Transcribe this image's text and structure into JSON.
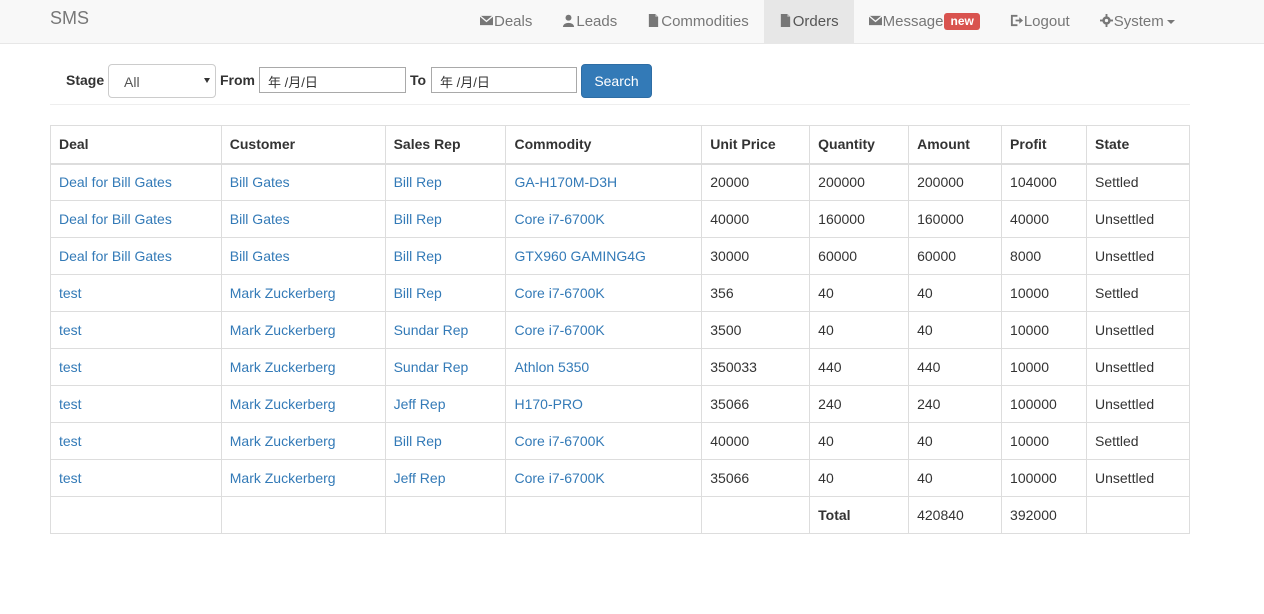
{
  "navbar": {
    "brand": "SMS",
    "items": [
      {
        "label": "Deals",
        "icon": "envelope-icon",
        "active": false
      },
      {
        "label": "Leads",
        "icon": "user-icon",
        "active": false
      },
      {
        "label": "Commodities",
        "icon": "file-icon",
        "active": false
      },
      {
        "label": "Orders",
        "icon": "file-icon",
        "active": true
      },
      {
        "label": "Message",
        "icon": "envelope-icon",
        "active": false,
        "badge": "new"
      },
      {
        "label": "Logout",
        "icon": "logout-icon",
        "active": false
      },
      {
        "label": "System",
        "icon": "gear-icon",
        "active": false,
        "dropdown": true
      }
    ]
  },
  "filter": {
    "stage_label": "Stage",
    "stage_value": "All",
    "from_label": "From",
    "from_value": "年 /月/日",
    "to_label": "To",
    "to_value": "年 /月/日",
    "search_label": "Search"
  },
  "table": {
    "headers": [
      "Deal",
      "Customer",
      "Sales Rep",
      "Commodity",
      "Unit Price",
      "Quantity",
      "Amount",
      "Profit",
      "State"
    ],
    "rows": [
      [
        "Deal for Bill Gates",
        "Bill Gates",
        "Bill Rep",
        "GA-H170M-D3H",
        "20000",
        "200000",
        "200000",
        "104000",
        "Settled"
      ],
      [
        "Deal for Bill Gates",
        "Bill Gates",
        "Bill Rep",
        "Core i7-6700K",
        "40000",
        "160000",
        "160000",
        "40000",
        "Unsettled"
      ],
      [
        "Deal for Bill Gates",
        "Bill Gates",
        "Bill Rep",
        "GTX960 GAMING4G",
        "30000",
        "60000",
        "60000",
        "8000",
        "Unsettled"
      ],
      [
        "test",
        "Mark Zuckerberg",
        "Bill Rep",
        "Core i7-6700K",
        "356",
        "40",
        "40",
        "10000",
        "Settled"
      ],
      [
        "test",
        "Mark Zuckerberg",
        "Sundar Rep",
        "Core i7-6700K",
        "3500",
        "40",
        "40",
        "10000",
        "Unsettled"
      ],
      [
        "test",
        "Mark Zuckerberg",
        "Sundar Rep",
        "Athlon 5350",
        "350033",
        "440",
        "440",
        "10000",
        "Unsettled"
      ],
      [
        "test",
        "Mark Zuckerberg",
        "Jeff Rep",
        "H170-PRO",
        "35066",
        "240",
        "240",
        "100000",
        "Unsettled"
      ],
      [
        "test",
        "Mark Zuckerberg",
        "Bill Rep",
        "Core i7-6700K",
        "40000",
        "40",
        "40",
        "10000",
        "Settled"
      ],
      [
        "test",
        "Mark Zuckerberg",
        "Jeff Rep",
        "Core i7-6700K",
        "35066",
        "40",
        "40",
        "100000",
        "Unsettled"
      ]
    ],
    "total_label": "Total",
    "total_amount": "420840",
    "total_profit": "392000"
  },
  "colors": {
    "link": "#337ab7",
    "primary": "#337ab7",
    "badge": "#d9534f",
    "navbar_bg": "#f8f8f8"
  }
}
